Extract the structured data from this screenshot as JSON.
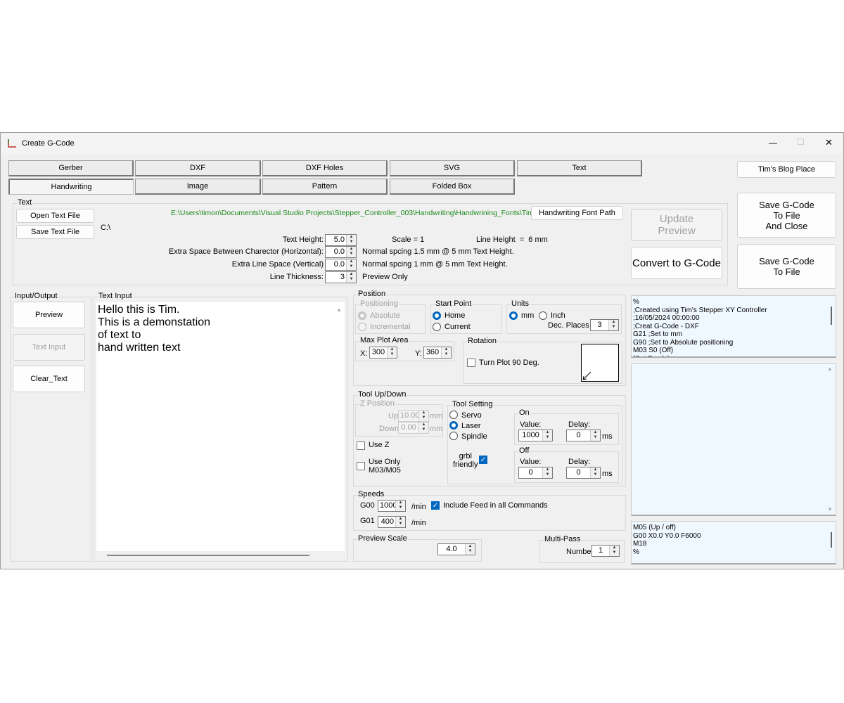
{
  "window": {
    "title": "Create G-Code",
    "minimize": "—",
    "maximize": "☐",
    "close": "✕"
  },
  "tabs_row1": [
    "Gerber",
    "DXF",
    "DXF Holes",
    "SVG",
    "Text"
  ],
  "tabs_row2": [
    "Handwriting",
    "Image",
    "Pattern",
    "Folded Box"
  ],
  "active_tab": "Handwriting",
  "blog_button": "Tim's Blog Place",
  "save_close_button": "Save G-Code\nTo File\nAnd Close",
  "save_button": "Save G-Code\nTo File",
  "text_group": {
    "legend": "Text",
    "open_file": "Open Text File",
    "save_file": "Save Text File",
    "current_dir": "C:\\",
    "font_path": "E:\\Users\\timon\\Documents\\Visual Studio Projects\\Stepper_Controller_003\\Handwriting\\Handwrining_Fonts\\Tims_HW",
    "font_path_button": "Handwriting Font Path",
    "text_height_label": "Text Height:",
    "text_height": "5.0",
    "extra_h_label": "Extra Space Between Charector (Horizontal):",
    "extra_h": "0.0",
    "extra_v_label": "Extra Line Space (Vertical)",
    "extra_v": "0.0",
    "thickness_label": "Line Thickness:",
    "thickness": "3",
    "scale": "Scale = 1",
    "line_height": "Line Height  =  6 mm",
    "note_h": "Normal spcing 1.5 mm @ 5 mm Text Height.",
    "note_v": "Normal spcing 1 mm @ 5 mm Text Height.",
    "note_t": "Preview Only"
  },
  "update_preview": "Update\nPreview",
  "convert": "Convert to G-Code",
  "io": {
    "legend": "Input/Output",
    "preview": "Preview",
    "text_input": "Text Input",
    "clear": "Clear_Text"
  },
  "text_input": {
    "legend": "Text Input",
    "lines": [
      "Hello this is Tim.",
      "This is a demonstation",
      "of text to",
      "hand written text"
    ]
  },
  "position": {
    "legend": "Position",
    "positioning": "Positioning",
    "absolute": "Absolute",
    "incremental": "Incremental",
    "start_point": "Start Point",
    "home": "Home",
    "current": "Current",
    "units": "Units",
    "mm": "mm",
    "inch": "Inch",
    "dec_places_label": "Dec. Places",
    "dec_places": "3",
    "max_plot": "Max Plot Area",
    "x_label": "X:",
    "x": "300",
    "y_label": "Y:",
    "y": "360",
    "rotation": "Rotation",
    "turn": "Turn Plot 90 Deg."
  },
  "tool": {
    "legend": "Tool Up/Down",
    "z_position": "Z Position",
    "up_label": "Up",
    "up": "10.00",
    "down_label": "Down",
    "down": "0.00",
    "mm": "mm",
    "use_z": "Use Z",
    "use_only": "Use Only\nM03/M05",
    "setting": "Tool Setting",
    "servo": "Servo",
    "laser": "Laser",
    "spindle": "Spindle",
    "grbl": "grbl\nfriendly",
    "on": "On",
    "off": "Off",
    "value_label": "Value:",
    "delay_label": "Delay:",
    "ms": "ms",
    "on_value": "1000",
    "on_delay": "0",
    "off_value": "0",
    "off_delay": "0"
  },
  "speeds": {
    "legend": "Speeds",
    "g00_label": "G00",
    "g00": "1000",
    "g01_label": "G01",
    "g01": "400",
    "unit": "/min",
    "include_feed": "Include Feed in all Commands"
  },
  "preview_scale": {
    "legend": "Preview Scale",
    "value": "4.0"
  },
  "multipass": {
    "legend": "Multi-Pass",
    "label": "Number:",
    "value": "1"
  },
  "gcode_header": "%\n;Created using Tim's Stepper XY Controller\n;16/05/2024 00:00:00\n;Creat G-Code - DXF\nG21 ;Set to mm\nG90 ;Set to Absolute positioning\nM03 S0 (Off)\n(Set Feeds)",
  "gcode_footer": "M05 (Up / off)\nG00 X0.0 Y0.0 F6000\nM18\n%"
}
